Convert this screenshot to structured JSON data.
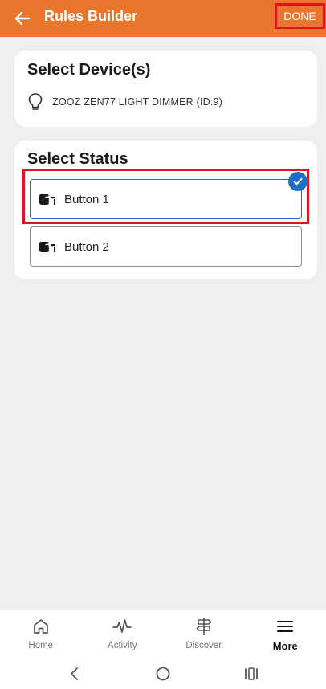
{
  "header": {
    "title": "Rules Builder",
    "done_label": "DONE",
    "back_icon": "arrow-left-icon"
  },
  "device_section": {
    "title": "Select Device(s)",
    "device_icon": "lightbulb-icon",
    "device_name": "ZOOZ ZEN77 LIGHT DIMMER (ID:9)"
  },
  "status_section": {
    "title": "Select Status",
    "options": [
      {
        "label": "Button 1",
        "icon": "hand-pointing-icon",
        "selected": true
      },
      {
        "label": "Button 2",
        "icon": "hand-pointing-icon",
        "selected": false
      }
    ]
  },
  "bottom_nav": {
    "items": [
      {
        "label": "Home",
        "icon": "home-icon",
        "active": false
      },
      {
        "label": "Activity",
        "icon": "activity-icon",
        "active": false
      },
      {
        "label": "Discover",
        "icon": "signpost-icon",
        "active": false
      },
      {
        "label": "More",
        "icon": "menu-icon",
        "active": true
      }
    ]
  },
  "system_nav": {
    "buttons": [
      "back-icon",
      "home-circle-icon",
      "recents-icon"
    ]
  },
  "colors": {
    "header_bg": "#e8762c",
    "highlight_red": "#e0141c",
    "selected_blue": "#1f6fc5",
    "page_bg": "#efefef"
  }
}
